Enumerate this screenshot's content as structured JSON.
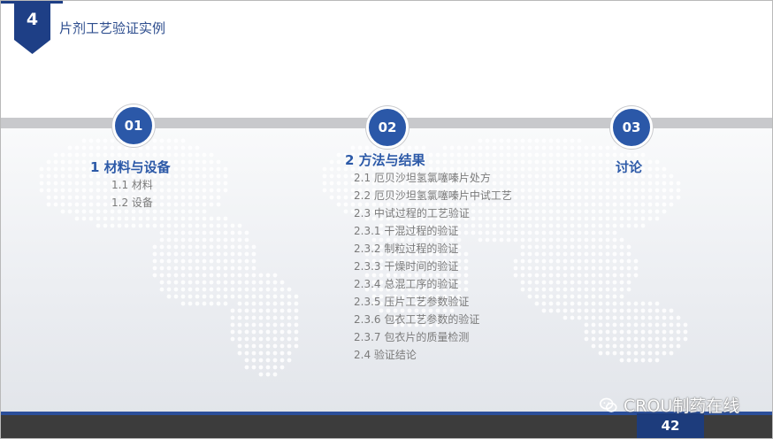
{
  "header": {
    "section_number": "4",
    "section_title": "片剂工艺验证实例"
  },
  "columns": [
    {
      "number": "01",
      "title": "1 材料与设备",
      "items": [
        "1.1 材料",
        "1.2 设备"
      ]
    },
    {
      "number": "02",
      "title": "2 方法与结果",
      "items": [
        "2.1 厄贝沙坦氢氯噻嗪片处方",
        "2.2 厄贝沙坦氢氯噻嗪片中试工艺",
        "2.3 中试过程的工艺验证",
        "2.3.1 干混过程的验证",
        "2.3.2 制粒过程的验证",
        "2.3.3 干燥时间的验证",
        "2.3.4 总混工序的验证",
        "2.3.5 压片工艺参数验证",
        "2.3.6 包衣工艺参数的验证",
        "2.3.7 包衣片的质量检测",
        "2.4 验证结论"
      ]
    },
    {
      "number": "03",
      "title": "讨论",
      "items": []
    }
  ],
  "footer": {
    "page_number": "42",
    "watermark": "CROU制药在线"
  },
  "colors": {
    "accent": "#2b58a8",
    "title": "#2d4d8e",
    "band": "#c8c9cc",
    "footer": "#3c3c3c",
    "page_box": "#1d3c7c"
  },
  "icons": {
    "watermark": "wechat-icon"
  }
}
